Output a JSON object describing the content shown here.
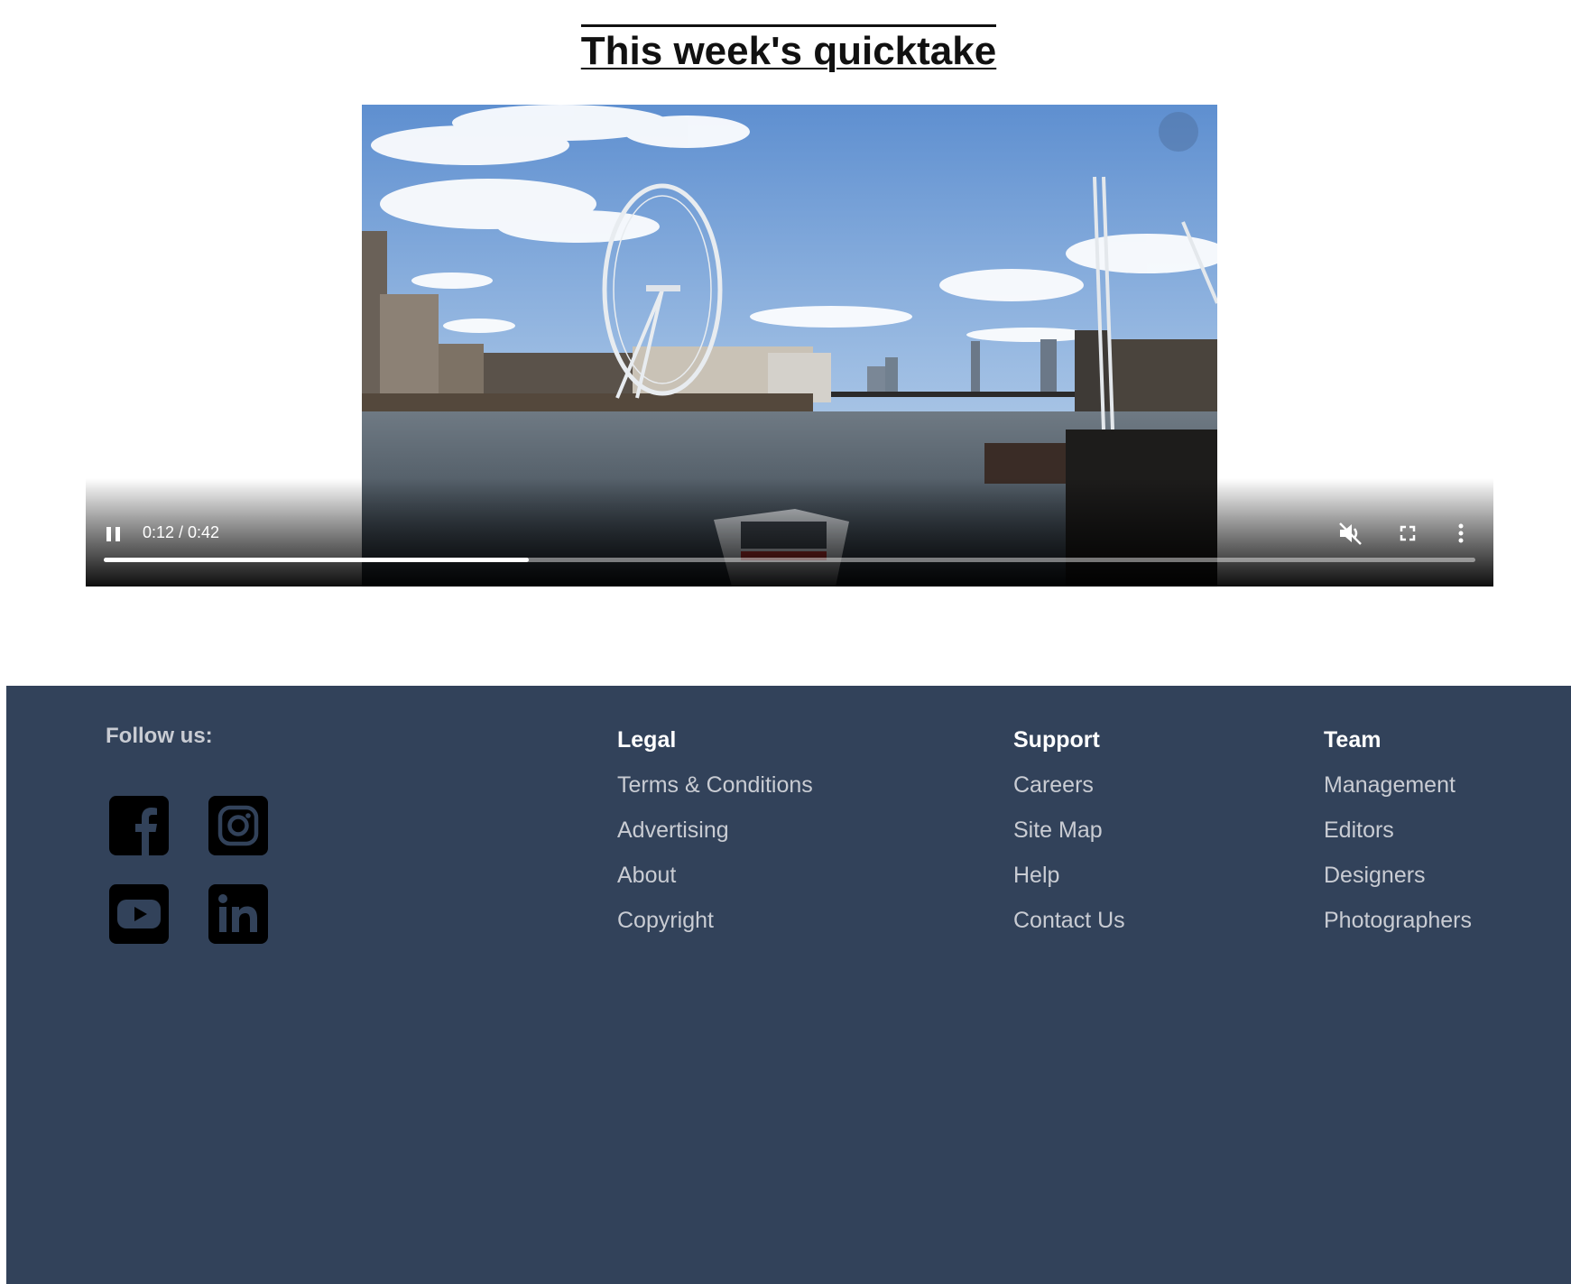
{
  "page": {
    "title": "This week's quicktake"
  },
  "video": {
    "current_time": "0:12",
    "duration": "0:42",
    "time_display": "0:12 / 0:42",
    "progress": 0.31,
    "state": "playing",
    "muted": true,
    "icons": [
      "pause-icon",
      "muted-volume-icon",
      "fullscreen-icon",
      "more-options-icon"
    ]
  },
  "footer": {
    "background": "#32425a",
    "follow_label": "Follow us:",
    "social": [
      "facebook-icon",
      "instagram-icon",
      "youtube-icon",
      "linkedin-icon"
    ],
    "columns": [
      {
        "heading": "Legal",
        "links": [
          "Terms & Conditions",
          "Advertising",
          "About",
          "Copyright"
        ]
      },
      {
        "heading": "Support",
        "links": [
          "Careers",
          "Site Map",
          "Help",
          "Contact Us"
        ]
      },
      {
        "heading": "Team",
        "links": [
          "Management",
          "Editors",
          "Designers",
          "Photographers"
        ]
      }
    ]
  }
}
